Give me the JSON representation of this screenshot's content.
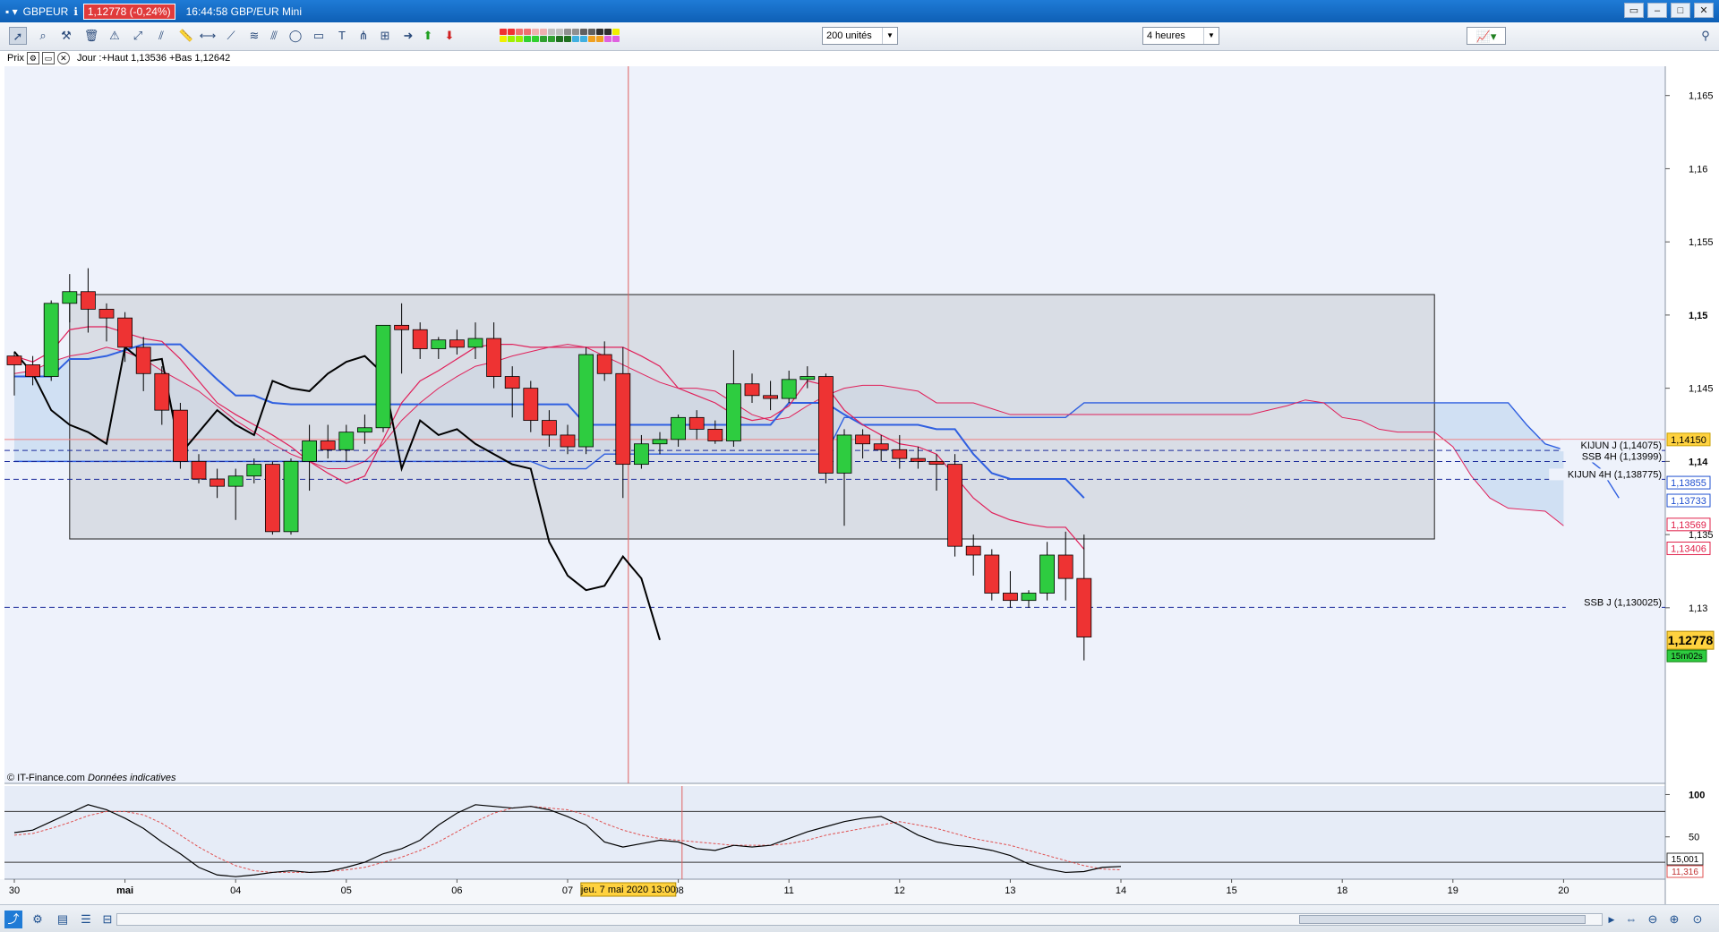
{
  "window": {
    "symbol": "GBPEUR",
    "info_icon": "info-icon",
    "price_badge": "1,12778 (-0,24%)",
    "time_title": "16:44:58 GBP/EUR Mini"
  },
  "toolbar": {
    "quantity_select": "200 unités",
    "period_select": "4 heures",
    "swatch_colors": [
      "#f03030",
      "#f07070",
      "#f0b0b0",
      "#c0c0c0",
      "#909090",
      "#606060",
      "#303030",
      "#f0f000",
      "#a0f000",
      "#30d030",
      "#30a030",
      "#207020",
      "#40b0e0",
      "#f0a020",
      "#e060e0"
    ]
  },
  "subbar": {
    "label": "Prix",
    "info": "Jour :+Haut 1,13536 +Bas 1,12642"
  },
  "watermark": {
    "source": "© IT-Finance.com",
    "note": "Données indicatives"
  },
  "chart_data": [
    {
      "type": "candlestick",
      "title": "",
      "ylim": [
        1.118,
        1.167
      ],
      "y_ticks": [
        "1,165",
        "1,16",
        "1,155",
        "1,15",
        "1,145",
        "1,14",
        "1,135",
        "1,13"
      ],
      "bold_ticks": [
        "1,15",
        "1,14"
      ],
      "x_labels": [
        {
          "i": 0,
          "label": "30"
        },
        {
          "i": 6,
          "label": "mai"
        },
        {
          "i": 12,
          "label": "04"
        },
        {
          "i": 18,
          "label": "05"
        },
        {
          "i": 24,
          "label": "06"
        },
        {
          "i": 30,
          "label": "07"
        },
        {
          "i": 36,
          "label": "08"
        },
        {
          "i": 42,
          "label": "11"
        },
        {
          "i": 48,
          "label": "12"
        },
        {
          "i": 54,
          "label": "13"
        },
        {
          "i": 60,
          "label": "14"
        },
        {
          "i": 66,
          "label": "15"
        },
        {
          "i": 72,
          "label": "18"
        },
        {
          "i": 78,
          "label": "19"
        },
        {
          "i": 84,
          "label": "20"
        }
      ],
      "crosshair_label": "jeu. 7 mai 2020 13:00",
      "crosshair_i": 33,
      "candles": [
        [
          1.1472,
          1.1475,
          1.1445,
          1.1466
        ],
        [
          1.1466,
          1.1472,
          1.1452,
          1.1458
        ],
        [
          1.1458,
          1.151,
          1.1455,
          1.1508
        ],
        [
          1.1508,
          1.1528,
          1.1495,
          1.1516
        ],
        [
          1.1516,
          1.1532,
          1.1488,
          1.1504
        ],
        [
          1.1504,
          1.1508,
          1.1482,
          1.1498
        ],
        [
          1.1498,
          1.1502,
          1.1468,
          1.1478
        ],
        [
          1.1478,
          1.1485,
          1.1448,
          1.146
        ],
        [
          1.146,
          1.1465,
          1.1425,
          1.1435
        ],
        [
          1.1435,
          1.144,
          1.1395,
          1.14
        ],
        [
          1.14,
          1.1405,
          1.1385,
          1.1388
        ],
        [
          1.1388,
          1.1395,
          1.1375,
          1.1383
        ],
        [
          1.1383,
          1.1395,
          1.136,
          1.139
        ],
        [
          1.139,
          1.1402,
          1.1385,
          1.1398
        ],
        [
          1.1398,
          1.14,
          1.135,
          1.1352
        ],
        [
          1.1352,
          1.1402,
          1.135,
          1.14
        ],
        [
          1.14,
          1.1425,
          1.138,
          1.1414
        ],
        [
          1.1414,
          1.1425,
          1.1402,
          1.1408
        ],
        [
          1.1408,
          1.1425,
          1.14,
          1.142
        ],
        [
          1.142,
          1.1432,
          1.1412,
          1.1423
        ],
        [
          1.1423,
          1.1493,
          1.142,
          1.1493
        ],
        [
          1.1493,
          1.1508,
          1.146,
          1.149
        ],
        [
          1.149,
          1.1495,
          1.147,
          1.1477
        ],
        [
          1.1477,
          1.1485,
          1.147,
          1.1483
        ],
        [
          1.1483,
          1.149,
          1.1473,
          1.1478
        ],
        [
          1.1478,
          1.1495,
          1.147,
          1.1484
        ],
        [
          1.1484,
          1.1495,
          1.145,
          1.1458
        ],
        [
          1.1458,
          1.1465,
          1.143,
          1.145
        ],
        [
          1.145,
          1.1455,
          1.142,
          1.1428
        ],
        [
          1.1428,
          1.1435,
          1.141,
          1.1418
        ],
        [
          1.1418,
          1.1425,
          1.1405,
          1.141
        ],
        [
          1.141,
          1.1478,
          1.1405,
          1.1473
        ],
        [
          1.1473,
          1.1482,
          1.1455,
          1.146
        ],
        [
          1.146,
          1.1478,
          1.1375,
          1.1398
        ],
        [
          1.1398,
          1.1418,
          1.1395,
          1.1412
        ],
        [
          1.1412,
          1.142,
          1.1405,
          1.1415
        ],
        [
          1.1415,
          1.1432,
          1.141,
          1.143
        ],
        [
          1.143,
          1.1435,
          1.1415,
          1.1422
        ],
        [
          1.1422,
          1.1428,
          1.1412,
          1.1414
        ],
        [
          1.1414,
          1.1476,
          1.141,
          1.1453
        ],
        [
          1.1453,
          1.146,
          1.144,
          1.1445
        ],
        [
          1.1445,
          1.1455,
          1.1435,
          1.1443
        ],
        [
          1.1443,
          1.1462,
          1.144,
          1.1456
        ],
        [
          1.1456,
          1.1465,
          1.145,
          1.1458
        ],
        [
          1.1458,
          1.146,
          1.1385,
          1.1392
        ],
        [
          1.1392,
          1.1422,
          1.1356,
          1.1418
        ],
        [
          1.1418,
          1.1422,
          1.1402,
          1.1412
        ],
        [
          1.1412,
          1.1418,
          1.14,
          1.1408
        ],
        [
          1.1408,
          1.1418,
          1.1395,
          1.1402
        ],
        [
          1.1402,
          1.141,
          1.1395,
          1.14
        ],
        [
          1.14,
          1.1405,
          1.138,
          1.1398
        ],
        [
          1.1398,
          1.1405,
          1.1335,
          1.1342
        ],
        [
          1.1342,
          1.135,
          1.1322,
          1.1336
        ],
        [
          1.1336,
          1.134,
          1.1305,
          1.131
        ],
        [
          1.131,
          1.1325,
          1.13,
          1.1305
        ],
        [
          1.1305,
          1.1312,
          1.13,
          1.131
        ],
        [
          1.131,
          1.1345,
          1.1305,
          1.1336
        ],
        [
          1.1336,
          1.1352,
          1.1305,
          1.132
        ],
        [
          1.132,
          1.135,
          1.1264,
          1.128
        ]
      ],
      "kijun_4h": [
        1.1458,
        1.1458,
        1.1458,
        1.147,
        1.147,
        1.1472,
        1.1476,
        1.148,
        1.148,
        1.148,
        1.1468,
        1.1456,
        1.1445,
        1.1445,
        1.144,
        1.1439,
        1.1439,
        1.1439,
        1.1439,
        1.1439,
        1.1439,
        1.1439,
        1.1439,
        1.1439,
        1.1439,
        1.1439,
        1.1439,
        1.1439,
        1.1439,
        1.1439,
        1.1439,
        1.1425,
        1.1425,
        1.1425,
        1.1425,
        1.1425,
        1.1425,
        1.1425,
        1.1425,
        1.1425,
        1.1425,
        1.1425,
        1.144,
        1.144,
        1.144,
        1.1432,
        1.1425,
        1.1425,
        1.1425,
        1.1425,
        1.1422,
        1.1422,
        1.1405,
        1.1392,
        1.1388,
        1.1388,
        1.1388,
        1.1388,
        1.1375
      ],
      "tenkan_4h": [
        1.1472,
        1.1468,
        1.1475,
        1.149,
        1.1492,
        1.1492,
        1.1488,
        1.1484,
        1.1482,
        1.147,
        1.1455,
        1.144,
        1.1432,
        1.1425,
        1.1418,
        1.141,
        1.14,
        1.1392,
        1.1385,
        1.139,
        1.1415,
        1.144,
        1.1455,
        1.1462,
        1.147,
        1.1478,
        1.148,
        1.148,
        1.1478,
        1.1478,
        1.1478,
        1.1478,
        1.1478,
        1.1478,
        1.1472,
        1.1465,
        1.145,
        1.1445,
        1.144,
        1.1432,
        1.1428,
        1.143,
        1.1438,
        1.1455,
        1.1452,
        1.1435,
        1.1425,
        1.1418,
        1.1412,
        1.141,
        1.1405,
        1.139,
        1.1375,
        1.1365,
        1.136,
        1.1357,
        1.1355,
        1.1355,
        1.134
      ],
      "chikou": [
        1.1475,
        1.146,
        1.1435,
        1.1425,
        1.142,
        1.1412,
        1.1478,
        1.1468,
        1.147,
        1.1405,
        1.142,
        1.1435,
        1.1425,
        1.1418,
        1.1455,
        1.145,
        1.1448,
        1.146,
        1.1468,
        1.1472,
        1.146,
        1.1395,
        1.1428,
        1.1418,
        1.1422,
        1.1412,
        1.1405,
        1.1398,
        1.1395,
        1.1345,
        1.1322,
        1.1312,
        1.1315,
        1.1335,
        1.132,
        1.1278
      ],
      "ssb_4h_line": [
        1.14,
        1.14,
        1.14,
        1.14,
        1.14,
        1.14,
        1.14,
        1.14,
        1.14,
        1.14,
        1.14,
        1.14,
        1.14,
        1.14,
        1.14,
        1.14,
        1.14,
        1.14,
        1.14,
        1.14,
        1.14,
        1.14,
        1.14,
        1.14,
        1.14,
        1.14,
        1.14,
        1.14,
        1.14,
        1.1395,
        1.1395,
        1.1395,
        1.1405,
        1.1405,
        1.1405,
        1.1405,
        1.1405,
        1.1405,
        1.1405,
        1.1405,
        1.1405,
        1.1405,
        1.1405,
        1.1405,
        1.1405,
        1.143,
        1.143,
        1.143,
        1.143,
        1.143,
        1.143,
        1.143,
        1.143,
        1.143,
        1.143,
        1.143,
        1.143,
        1.143,
        1.144,
        1.144,
        1.144,
        1.144,
        1.144,
        1.144,
        1.144,
        1.144,
        1.144,
        1.144,
        1.144,
        1.144,
        1.144,
        1.144,
        1.144,
        1.144,
        1.144,
        1.144,
        1.144,
        1.144,
        1.144,
        1.144,
        1.144,
        1.144,
        1.1425,
        1.1412,
        1.1408,
        1.1405,
        1.1395,
        1.1375
      ],
      "ssa_4h_line": [
        1.146,
        1.1462,
        1.1468,
        1.1472,
        1.1474,
        1.1478,
        1.1475,
        1.147,
        1.1462,
        1.1455,
        1.1448,
        1.1438,
        1.1428,
        1.142,
        1.1412,
        1.1405,
        1.14,
        1.1395,
        1.1395,
        1.14,
        1.1412,
        1.1428,
        1.144,
        1.145,
        1.1458,
        1.1465,
        1.1468,
        1.1472,
        1.1475,
        1.1478,
        1.148,
        1.1478,
        1.1472,
        1.1466,
        1.146,
        1.1454,
        1.145,
        1.145,
        1.1448,
        1.144,
        1.1432,
        1.1428,
        1.143,
        1.1438,
        1.1445,
        1.145,
        1.1452,
        1.1452,
        1.145,
        1.1448,
        1.144,
        1.144,
        1.144,
        1.1436,
        1.1432,
        1.1432,
        1.1432,
        1.1432,
        1.1432,
        1.1432,
        1.1432,
        1.1432,
        1.1432,
        1.1432,
        1.1432,
        1.1432,
        1.1432,
        1.1432,
        1.1435,
        1.1438,
        1.1442,
        1.144,
        1.143,
        1.1428,
        1.1422,
        1.142,
        1.142,
        1.142,
        1.141,
        1.139,
        1.1375,
        1.1368,
        1.1367,
        1.1366,
        1.1356
      ],
      "rectangle": {
        "i_start": 3,
        "i_end": 77,
        "y_top": 1.1514,
        "y_bottom": 1.1347
      },
      "levels": [
        {
          "label": "KIJUN J (1,14075)",
          "value": 1.14075,
          "style": "dashed"
        },
        {
          "label": "SSB 4H (1,13999)",
          "value": 1.13999,
          "style": "dashed"
        },
        {
          "label": "KIJUN 4H (1,138775)",
          "value": 1.138775,
          "style": "dashed"
        },
        {
          "label": "SSB J (1,130025)",
          "value": 1.130025,
          "style": "dashed"
        }
      ],
      "red_hline": 1.1415,
      "price_tags": [
        {
          "text": "1,14150",
          "value": 1.1415,
          "fill": "#ffd23f",
          "color": "#000000"
        },
        {
          "text": "1,13855",
          "value": 1.13855,
          "fill": "#ffffff",
          "color": "#2050d0"
        },
        {
          "text": "1,13733",
          "value": 1.13733,
          "fill": "#ffffff",
          "color": "#2050d0"
        },
        {
          "text": "1,13569",
          "value": 1.13569,
          "fill": "#ffffff",
          "color": "#e0204a"
        },
        {
          "text": "1,13406",
          "value": 1.13406,
          "fill": "#ffffff",
          "color": "#e0204a"
        }
      ],
      "current": {
        "text": "1,12778",
        "value": 1.12778,
        "timer": "15m02s"
      }
    },
    {
      "type": "line",
      "title": "",
      "ylim": [
        0,
        110
      ],
      "y_ticks": [
        "100",
        "50"
      ],
      "levels": [
        80,
        20
      ],
      "tags": [
        "15,001",
        "11,316"
      ],
      "main": [
        55,
        58,
        68,
        78,
        88,
        82,
        72,
        60,
        44,
        30,
        14,
        5,
        3,
        5,
        8,
        10,
        8,
        9,
        14,
        20,
        30,
        36,
        46,
        64,
        78,
        88,
        86,
        84,
        86,
        82,
        74,
        64,
        44,
        38,
        42,
        46,
        44,
        36,
        34,
        40,
        38,
        40,
        48,
        56,
        62,
        68,
        72,
        74,
        64,
        52,
        44,
        40,
        38,
        34,
        28,
        18,
        12,
        8,
        9,
        14,
        15
      ],
      "signal": [
        52,
        54,
        60,
        67,
        75,
        80,
        80,
        76,
        66,
        52,
        38,
        26,
        16,
        10,
        8,
        8,
        8,
        9,
        11,
        14,
        20,
        26,
        34,
        44,
        56,
        68,
        78,
        84,
        86,
        84,
        82,
        76,
        66,
        58,
        52,
        48,
        46,
        44,
        42,
        40,
        40,
        40,
        42,
        46,
        52,
        56,
        60,
        64,
        68,
        64,
        60,
        54,
        48,
        44,
        40,
        34,
        28,
        22,
        16,
        12,
        11
      ]
    }
  ],
  "bottombar": {
    "icons": [
      "share-icon",
      "indicators-icon",
      "drawings-icon",
      "list-icon",
      "grid-icon"
    ],
    "zoom_icons": [
      "fit-icon",
      "zoom-out-icon",
      "zoom-in-icon",
      "zoom-reset-icon"
    ]
  }
}
